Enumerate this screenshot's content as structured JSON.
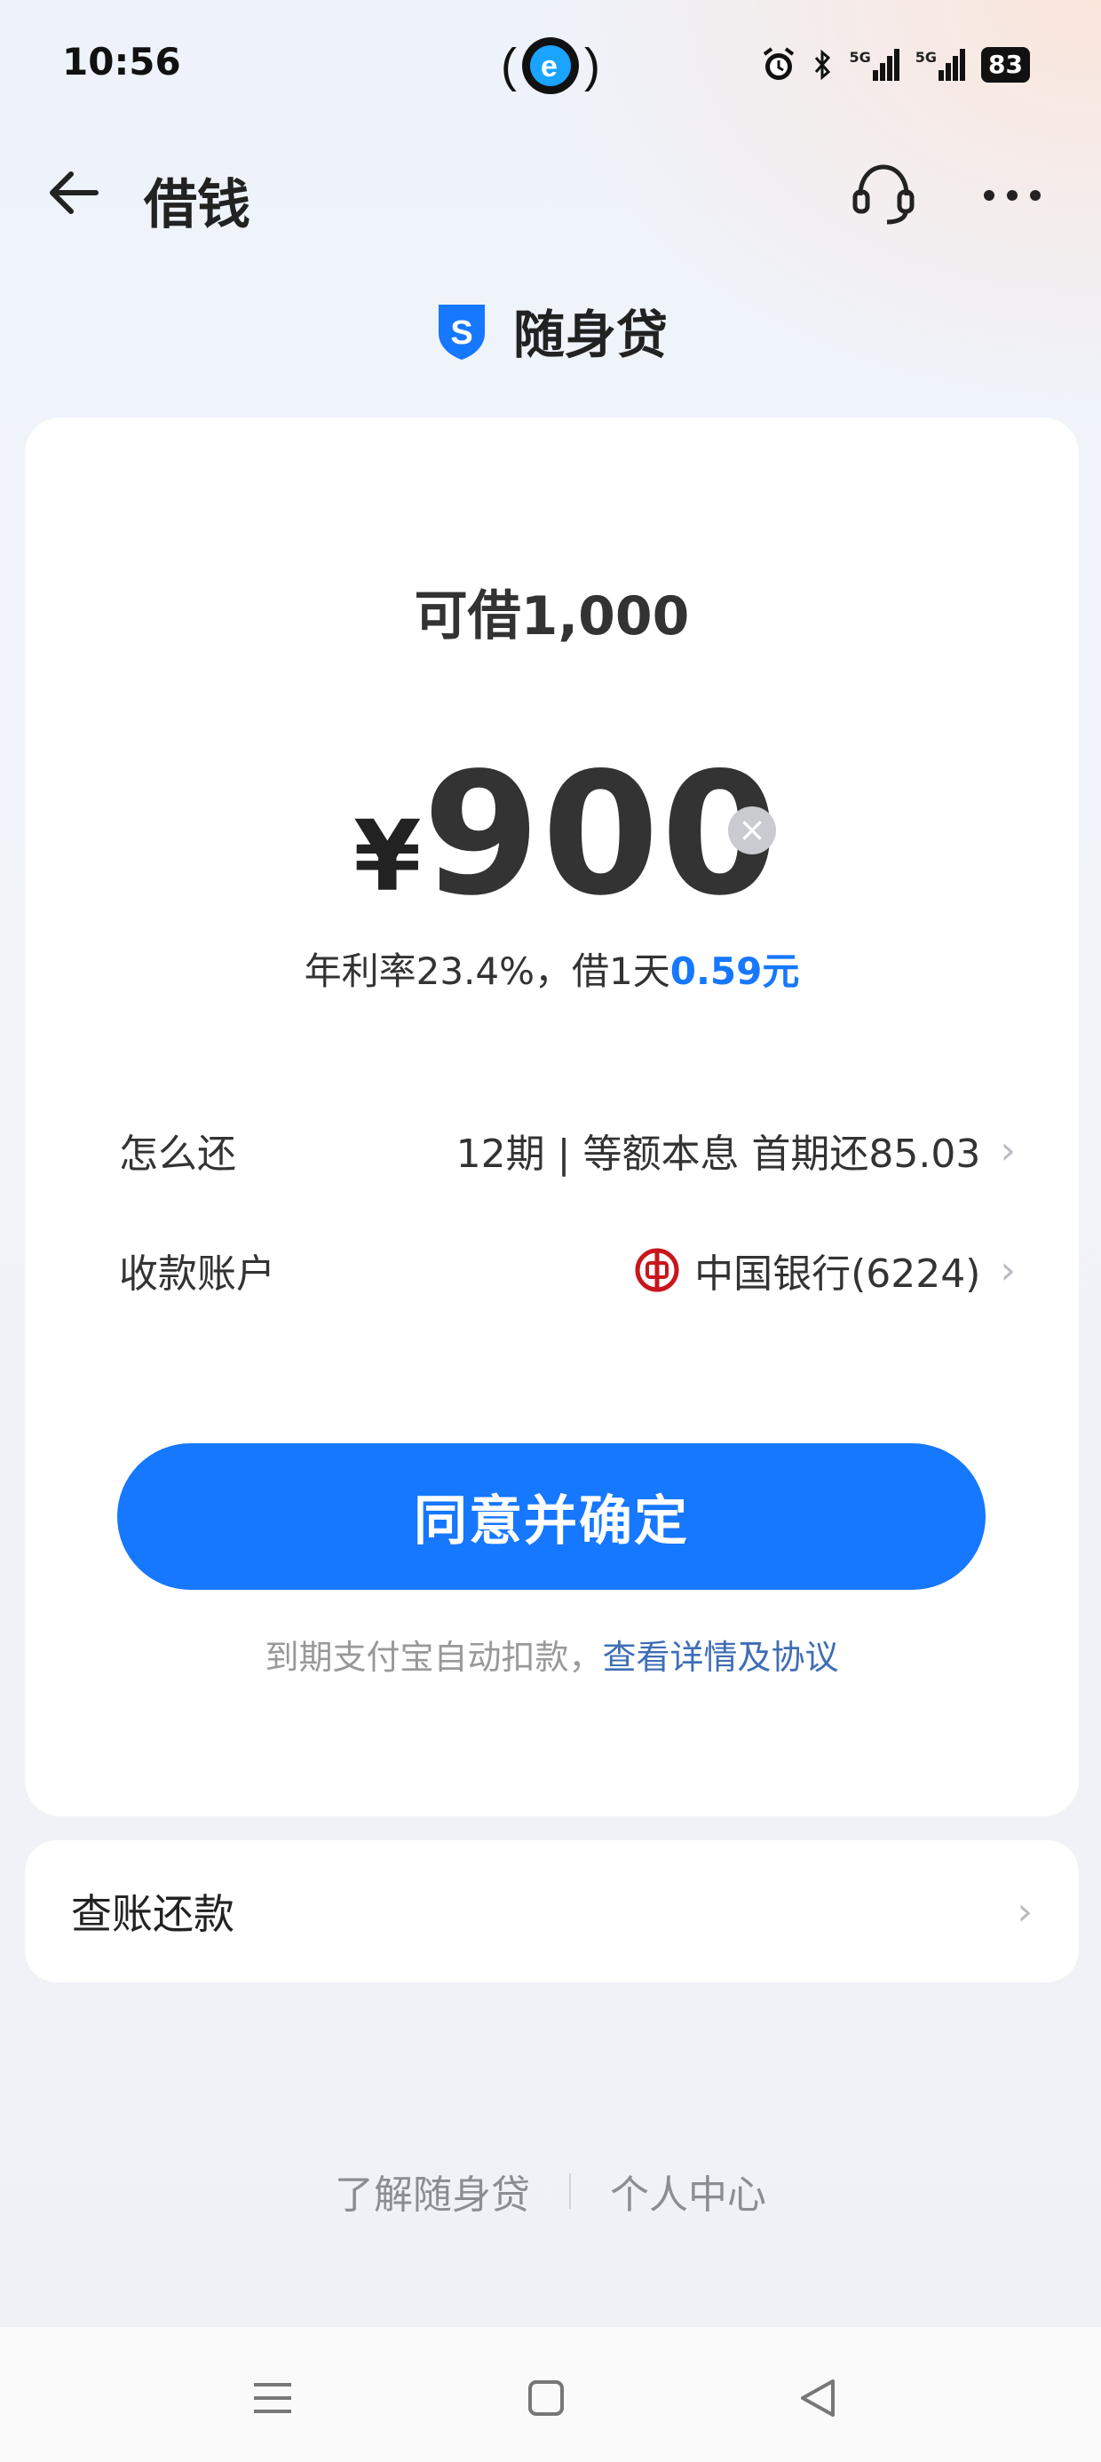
{
  "status_bar": {
    "time": "10:56",
    "signal1": "5G",
    "signal2": "5G",
    "battery": "83"
  },
  "header": {
    "title": "借钱"
  },
  "brand": {
    "logo_letter": "S",
    "name": "随身贷"
  },
  "loan": {
    "available_label": "可借1,000",
    "currency": "¥",
    "amount": "900",
    "rate_text": "年利率23.4%，借1天",
    "daily_cost": "0.59元"
  },
  "rows": [
    {
      "label": "怎么还",
      "value": "12期 | 等额本息 首期还85.03"
    },
    {
      "label": "收款账户",
      "value": "中国银行(6224)"
    }
  ],
  "confirm_button": "同意并确定",
  "notice": {
    "text": "到期支付宝自动扣款，",
    "link": "查看详情及协议"
  },
  "bill": {
    "label": "查账还款"
  },
  "footer": {
    "link1": "了解随身贷",
    "link2": "个人中心"
  },
  "colors": {
    "accent": "#1677ff",
    "link": "#3f6eb5",
    "bank_red": "#c8161d"
  }
}
